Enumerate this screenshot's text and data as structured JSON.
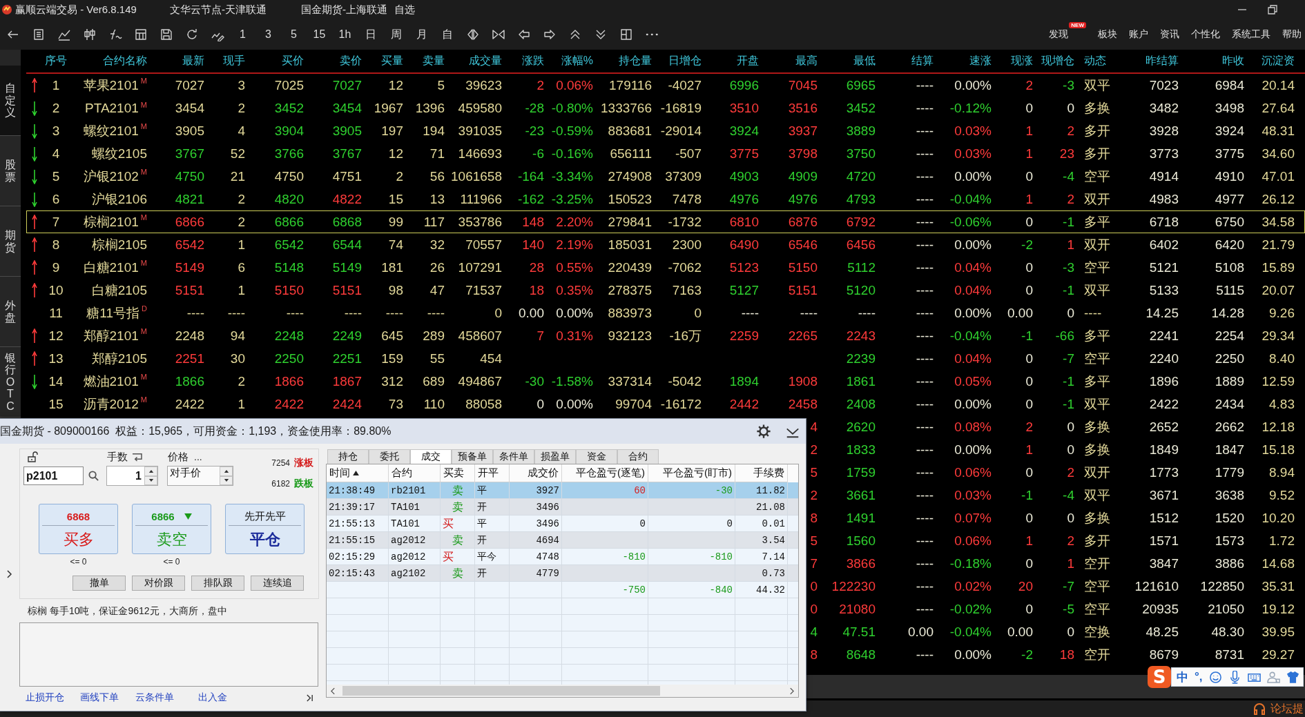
{
  "window": {
    "title_items": [
      "赢顺云端交易 - Ver6.8.149",
      "文华云节点-天津联通",
      "国金期货-上海联通",
      "自选"
    ]
  },
  "toolbar": {
    "periods": [
      "1",
      "3",
      "5",
      "15",
      "1h",
      "日",
      "周",
      "月",
      "自"
    ],
    "menu": [
      {
        "label": "发现",
        "badge": "NEW"
      },
      {
        "label": "板块"
      },
      {
        "label": "账户"
      },
      {
        "label": "资讯"
      },
      {
        "label": "个性化"
      },
      {
        "label": "系统工具"
      },
      {
        "label": "帮助"
      }
    ]
  },
  "sidebar": {
    "items": [
      {
        "label": "自定义",
        "selected": true
      },
      {
        "label": "股票",
        "selected": false
      },
      {
        "label": "期货",
        "selected": false
      },
      {
        "label": "外盘",
        "selected": false
      },
      {
        "label": "银行OTC",
        "selected": false
      }
    ]
  },
  "quote_table": {
    "columns": [
      "序号",
      "合约名称",
      "最新",
      "现手",
      "买价",
      "卖价",
      "买量",
      "卖量",
      "成交量",
      "涨跌",
      "涨幅%",
      "持仓量",
      "日增仓",
      "开盘",
      "最高",
      "最低",
      "结算",
      "速涨",
      "现涨",
      "现增仓",
      "动态",
      "昨结算",
      "昨收",
      "沉淀资"
    ],
    "rows": [
      {
        "kind": "rise",
        "selected": false,
        "cells": [
          "1",
          "苹果2101$^{M}$",
          {
            "text": "7027",
            "kind": "flat"
          },
          "3",
          {
            "text": "7025",
            "kind": "flat"
          },
          {
            "text": "7027",
            "kind": "fall"
          },
          "12",
          "5",
          "39623",
          {
            "text": "2",
            "kind": "rise"
          },
          {
            "text": "0.06%",
            "kind": "rise"
          },
          "179116",
          "-4027",
          {
            "text": "6996",
            "kind": "fall"
          },
          {
            "text": "7045",
            "kind": "rise"
          },
          {
            "text": "6965",
            "kind": "fall"
          },
          "----",
          {
            "text": "0.00%",
            "kind": "flat"
          },
          {
            "text": "2",
            "kind": "rise"
          },
          {
            "text": "-3",
            "kind": "fall"
          },
          "双平",
          "7023",
          "6984",
          "20.14"
        ]
      },
      {
        "kind": "fall",
        "selected": false,
        "cells": [
          "2",
          "PTA2101$^{M}$",
          {
            "text": "3454",
            "kind": "flat"
          },
          "2",
          {
            "text": "3452",
            "kind": "fall"
          },
          {
            "text": "3454",
            "kind": "fall"
          },
          "1967",
          "1396",
          "459580",
          {
            "text": "-28",
            "kind": "fall"
          },
          {
            "text": "-0.80%",
            "kind": "fall"
          },
          "1333766",
          "-16819",
          {
            "text": "3510",
            "kind": "rise"
          },
          {
            "text": "3516",
            "kind": "rise"
          },
          {
            "text": "3452",
            "kind": "fall"
          },
          "----",
          {
            "text": "-0.12%",
            "kind": "fall"
          },
          {
            "text": "0",
            "kind": "flat"
          },
          {
            "text": "0",
            "kind": "flat"
          },
          "多换",
          "3482",
          "3498",
          "27.64"
        ]
      },
      {
        "kind": "fall",
        "selected": false,
        "cells": [
          "3",
          "螺纹2101$^{M}$",
          {
            "text": "3905",
            "kind": "flat"
          },
          "4",
          {
            "text": "3904",
            "kind": "fall"
          },
          {
            "text": "3905",
            "kind": "fall"
          },
          "197",
          "194",
          "391035",
          {
            "text": "-23",
            "kind": "fall"
          },
          {
            "text": "-0.59%",
            "kind": "fall"
          },
          "883681",
          "-29014",
          {
            "text": "3924",
            "kind": "fall"
          },
          {
            "text": "3937",
            "kind": "rise"
          },
          {
            "text": "3889",
            "kind": "fall"
          },
          "----",
          {
            "text": "0.03%",
            "kind": "rise"
          },
          {
            "text": "1",
            "kind": "rise"
          },
          {
            "text": "2",
            "kind": "rise"
          },
          "多开",
          "3928",
          "3924",
          "48.31"
        ]
      },
      {
        "kind": "fall",
        "selected": false,
        "cells": [
          "4",
          "螺纹2105",
          {
            "text": "3767",
            "kind": "fall"
          },
          "52",
          {
            "text": "3766",
            "kind": "fall"
          },
          {
            "text": "3767",
            "kind": "fall"
          },
          "12",
          "71",
          "146693",
          {
            "text": "-6",
            "kind": "fall"
          },
          {
            "text": "-0.16%",
            "kind": "fall"
          },
          "656111",
          "-507",
          {
            "text": "3775",
            "kind": "rise"
          },
          {
            "text": "3798",
            "kind": "rise"
          },
          {
            "text": "3750",
            "kind": "fall"
          },
          "----",
          {
            "text": "0.03%",
            "kind": "rise"
          },
          {
            "text": "1",
            "kind": "rise"
          },
          {
            "text": "23",
            "kind": "rise"
          },
          "多开",
          "3773",
          "3775",
          "34.60"
        ]
      },
      {
        "kind": "fall",
        "selected": false,
        "cells": [
          "5",
          "沪银2102$^{M}$",
          {
            "text": "4750",
            "kind": "fall"
          },
          "21",
          {
            "text": "4750",
            "kind": "flat"
          },
          {
            "text": "4751",
            "kind": "flat"
          },
          "2",
          "56",
          "1061658",
          {
            "text": "-164",
            "kind": "fall"
          },
          {
            "text": "-3.34%",
            "kind": "fall"
          },
          "274908",
          "37309",
          {
            "text": "4903",
            "kind": "fall"
          },
          {
            "text": "4909",
            "kind": "fall"
          },
          {
            "text": "4720",
            "kind": "fall"
          },
          "----",
          {
            "text": "0.00%",
            "kind": "flat"
          },
          {
            "text": "0",
            "kind": "flat"
          },
          {
            "text": "-4",
            "kind": "fall"
          },
          "空平",
          "4914",
          "4910",
          "47.01"
        ]
      },
      {
        "kind": "fall",
        "selected": false,
        "cells": [
          "6",
          "沪银2106",
          {
            "text": "4821",
            "kind": "fall"
          },
          "2",
          {
            "text": "4820",
            "kind": "fall"
          },
          {
            "text": "4822",
            "kind": "rise"
          },
          "15",
          "13",
          "111966",
          {
            "text": "-162",
            "kind": "fall"
          },
          {
            "text": "-3.25%",
            "kind": "fall"
          },
          "150523",
          "7478",
          {
            "text": "4976",
            "kind": "fall"
          },
          {
            "text": "4976",
            "kind": "fall"
          },
          {
            "text": "4793",
            "kind": "fall"
          },
          "----",
          {
            "text": "-0.04%",
            "kind": "fall"
          },
          {
            "text": "1",
            "kind": "rise"
          },
          {
            "text": "2",
            "kind": "rise"
          },
          "双开",
          "4983",
          "4977",
          "26.12"
        ]
      },
      {
        "kind": "rise",
        "selected": true,
        "cells": [
          "7",
          "棕榈2101$^{M}$",
          {
            "text": "6866",
            "kind": "rise"
          },
          "2",
          {
            "text": "6866",
            "kind": "fall"
          },
          {
            "text": "6868",
            "kind": "fall"
          },
          "99",
          "117",
          "353786",
          {
            "text": "148",
            "kind": "rise"
          },
          {
            "text": "2.20%",
            "kind": "rise"
          },
          "279841",
          "-1732",
          {
            "text": "6810",
            "kind": "rise"
          },
          {
            "text": "6876",
            "kind": "rise"
          },
          {
            "text": "6792",
            "kind": "rise"
          },
          "----",
          {
            "text": "-0.06%",
            "kind": "fall"
          },
          {
            "text": "0",
            "kind": "flat"
          },
          {
            "text": "-1",
            "kind": "fall"
          },
          "多平",
          "6718",
          "6750",
          "34.58"
        ]
      },
      {
        "kind": "rise",
        "selected": false,
        "cells": [
          "8",
          "棕榈2105",
          {
            "text": "6542",
            "kind": "rise"
          },
          "1",
          {
            "text": "6542",
            "kind": "fall"
          },
          {
            "text": "6544",
            "kind": "fall"
          },
          "74",
          "32",
          "70557",
          {
            "text": "140",
            "kind": "rise"
          },
          {
            "text": "2.19%",
            "kind": "rise"
          },
          "185031",
          "2300",
          {
            "text": "6490",
            "kind": "rise"
          },
          {
            "text": "6546",
            "kind": "rise"
          },
          {
            "text": "6456",
            "kind": "rise"
          },
          "----",
          {
            "text": "0.00%",
            "kind": "flat"
          },
          {
            "text": "-2",
            "kind": "fall"
          },
          {
            "text": "1",
            "kind": "rise"
          },
          "双开",
          "6402",
          "6420",
          "21.79"
        ]
      },
      {
        "kind": "rise",
        "selected": false,
        "cells": [
          "9",
          "白糖2101$^{M}$",
          {
            "text": "5149",
            "kind": "rise"
          },
          "6",
          {
            "text": "5148",
            "kind": "fall"
          },
          {
            "text": "5149",
            "kind": "fall"
          },
          "181",
          "26",
          "107291",
          {
            "text": "28",
            "kind": "rise"
          },
          {
            "text": "0.55%",
            "kind": "rise"
          },
          "220439",
          "-7062",
          {
            "text": "5123",
            "kind": "rise"
          },
          {
            "text": "5150",
            "kind": "rise"
          },
          {
            "text": "5112",
            "kind": "fall"
          },
          "----",
          {
            "text": "0.04%",
            "kind": "rise"
          },
          {
            "text": "0",
            "kind": "flat"
          },
          {
            "text": "-3",
            "kind": "fall"
          },
          "空平",
          "5121",
          "5108",
          "15.89"
        ]
      },
      {
        "kind": "rise",
        "selected": false,
        "cells": [
          "10",
          "白糖2105",
          {
            "text": "5151",
            "kind": "rise"
          },
          "1",
          {
            "text": "5150",
            "kind": "rise"
          },
          {
            "text": "5151",
            "kind": "rise"
          },
          "98",
          "47",
          "71537",
          {
            "text": "18",
            "kind": "rise"
          },
          {
            "text": "0.35%",
            "kind": "rise"
          },
          "278375",
          "7163",
          {
            "text": "5127",
            "kind": "fall"
          },
          {
            "text": "5151",
            "kind": "rise"
          },
          {
            "text": "5120",
            "kind": "fall"
          },
          "----",
          {
            "text": "0.04%",
            "kind": "rise"
          },
          {
            "text": "0",
            "kind": "flat"
          },
          {
            "text": "-1",
            "kind": "fall"
          },
          "双平",
          "5133",
          "5115",
          "20.07"
        ]
      },
      {
        "kind": "flat",
        "selected": false,
        "cells": [
          "11",
          "糖11号指$^{D}$",
          {
            "text": "----",
            "kind": "flat"
          },
          "----",
          {
            "text": "----",
            "kind": "flat"
          },
          {
            "text": "----",
            "kind": "flat"
          },
          "----",
          "----",
          "0",
          {
            "text": "0.00",
            "kind": "flat"
          },
          {
            "text": "0.00%",
            "kind": "flat"
          },
          "883973",
          "0",
          {
            "text": "----",
            "kind": "flat"
          },
          {
            "text": "----",
            "kind": "flat"
          },
          {
            "text": "----",
            "kind": "flat"
          },
          "----",
          {
            "text": "0.00%",
            "kind": "flat"
          },
          {
            "text": "0.00",
            "kind": "flat"
          },
          {
            "text": "0",
            "kind": "flat"
          },
          "----",
          "14.25",
          "14.28",
          "9.26"
        ]
      },
      {
        "kind": "rise",
        "selected": false,
        "cells": [
          "12",
          "郑醇2101$^{M}$",
          {
            "text": "2248",
            "kind": "flat"
          },
          "94",
          {
            "text": "2248",
            "kind": "fall"
          },
          {
            "text": "2249",
            "kind": "fall"
          },
          "645",
          "289",
          "458607",
          {
            "text": "7",
            "kind": "rise"
          },
          {
            "text": "0.31%",
            "kind": "rise"
          },
          "932123",
          "-16万",
          {
            "text": "2259",
            "kind": "rise"
          },
          {
            "text": "2265",
            "kind": "rise"
          },
          {
            "text": "2243",
            "kind": "rise"
          },
          "----",
          {
            "text": "-0.04%",
            "kind": "fall"
          },
          {
            "text": "-1",
            "kind": "fall"
          },
          {
            "text": "-66",
            "kind": "fall"
          },
          "多平",
          "2241",
          "2254",
          "29.34"
        ]
      },
      {
        "kind": "rise",
        "selected": false,
        "cells": [
          "13",
          "郑醇2105",
          {
            "text": "2251",
            "kind": "rise"
          },
          "30",
          {
            "text": "2250",
            "kind": "fall"
          },
          {
            "text": "2251",
            "kind": "fall"
          },
          "159",
          "55",
          "454",
          null,
          null,
          null,
          null,
          null,
          null,
          {
            "text": "2239",
            "kind": "fall"
          },
          "----",
          {
            "text": "0.04%",
            "kind": "rise"
          },
          {
            "text": "0",
            "kind": "flat"
          },
          {
            "text": "-7",
            "kind": "fall"
          },
          "空平",
          "2240",
          "2250",
          "8.40"
        ]
      },
      {
        "kind": "fall",
        "selected": false,
        "cells": [
          "14",
          "燃油2101$^{M}$",
          {
            "text": "1866",
            "kind": "fall"
          },
          "2",
          {
            "text": "1866",
            "kind": "rise"
          },
          {
            "text": "1867",
            "kind": "rise"
          },
          "312",
          "689",
          "494867",
          {
            "text": "-30",
            "kind": "fall"
          },
          {
            "text": "-1.58%",
            "kind": "fall"
          },
          "337314",
          "-5042",
          {
            "text": "1894",
            "kind": "fall"
          },
          {
            "text": "1908",
            "kind": "rise"
          },
          {
            "text": "1861",
            "kind": "fall"
          },
          "----",
          {
            "text": "0.05%",
            "kind": "rise"
          },
          {
            "text": "0",
            "kind": "flat"
          },
          {
            "text": "-1",
            "kind": "fall"
          },
          "多平",
          "1896",
          "1889",
          "12.59"
        ]
      },
      {
        "kind": "flat",
        "selected": false,
        "cells": [
          "15",
          "沥青2012$^{M}$",
          {
            "text": "2422",
            "kind": "flat"
          },
          "1",
          {
            "text": "2422",
            "kind": "rise"
          },
          {
            "text": "2424",
            "kind": "rise"
          },
          "73",
          "110",
          "88058",
          {
            "text": "0",
            "kind": "flat"
          },
          {
            "text": "0.00%",
            "kind": "flat"
          },
          "99704",
          "-16172",
          {
            "text": "2442",
            "kind": "rise"
          },
          {
            "text": "2458",
            "kind": "rise"
          },
          {
            "text": "2408",
            "kind": "fall"
          },
          "----",
          {
            "text": "0.00%",
            "kind": "flat"
          },
          {
            "text": "0",
            "kind": "flat"
          },
          {
            "text": "-1",
            "kind": "fall"
          },
          "双平",
          "2422",
          "2434",
          "4.83"
        ]
      },
      {
        "selected": false,
        "cells": [
          {
            "text": "4",
            "kind": "rise"
          },
          {
            "text": "2620",
            "kind": "fall"
          },
          "----",
          {
            "text": "0.08%",
            "kind": "rise"
          },
          {
            "text": "2",
            "kind": "rise"
          },
          {
            "text": "0",
            "kind": "flat"
          },
          "多换",
          "2652",
          "2662",
          "12.18"
        ]
      },
      {
        "selected": false,
        "cells": [
          {
            "text": "2",
            "kind": "rise"
          },
          {
            "text": "1833",
            "kind": "fall"
          },
          "----",
          {
            "text": "0.00%",
            "kind": "flat"
          },
          {
            "text": "1",
            "kind": "rise"
          },
          {
            "text": "0",
            "kind": "flat"
          },
          "多换",
          "1849",
          "1847",
          "15.18"
        ]
      },
      {
        "selected": false,
        "cells": [
          {
            "text": "5",
            "kind": "rise"
          },
          {
            "text": "1759",
            "kind": "fall"
          },
          "----",
          {
            "text": "0.06%",
            "kind": "rise"
          },
          {
            "text": "0",
            "kind": "flat"
          },
          {
            "text": "2",
            "kind": "rise"
          },
          "双开",
          "1773",
          "1779",
          "8.94"
        ]
      },
      {
        "selected": false,
        "cells": [
          {
            "text": "2",
            "kind": "rise"
          },
          {
            "text": "3661",
            "kind": "fall"
          },
          "----",
          {
            "text": "0.03%",
            "kind": "rise"
          },
          {
            "text": "-1",
            "kind": "fall"
          },
          {
            "text": "-4",
            "kind": "fall"
          },
          "双平",
          "3671",
          "3638",
          "9.52"
        ]
      },
      {
        "selected": false,
        "cells": [
          {
            "text": "8",
            "kind": "rise"
          },
          {
            "text": "1491",
            "kind": "fall"
          },
          "----",
          {
            "text": "0.07%",
            "kind": "rise"
          },
          {
            "text": "0",
            "kind": "flat"
          },
          {
            "text": "0",
            "kind": "flat"
          },
          "多换",
          "1512",
          "1520",
          "10.20"
        ]
      },
      {
        "selected": false,
        "cells": [
          {
            "text": "5",
            "kind": "rise"
          },
          {
            "text": "1560",
            "kind": "fall"
          },
          "----",
          {
            "text": "0.06%",
            "kind": "rise"
          },
          {
            "text": "1",
            "kind": "rise"
          },
          {
            "text": "2",
            "kind": "rise"
          },
          "多开",
          "1571",
          "1573",
          "1.72"
        ]
      },
      {
        "selected": false,
        "cells": [
          {
            "text": "7",
            "kind": "rise"
          },
          {
            "text": "3866",
            "kind": "rise"
          },
          "----",
          {
            "text": "-0.18%",
            "kind": "fall"
          },
          {
            "text": "0",
            "kind": "flat"
          },
          {
            "text": "1",
            "kind": "rise"
          },
          "空开",
          "3847",
          "3886",
          "14.68"
        ]
      },
      {
        "selected": false,
        "cells": [
          {
            "text": "0",
            "kind": "rise"
          },
          {
            "text": "122230",
            "kind": "rise"
          },
          "----",
          {
            "text": "0.02%",
            "kind": "rise"
          },
          {
            "text": "20",
            "kind": "rise"
          },
          {
            "text": "-7",
            "kind": "fall"
          },
          "空平",
          "121610",
          "122850",
          "35.31"
        ]
      },
      {
        "selected": false,
        "cells": [
          {
            "text": "0",
            "kind": "rise"
          },
          {
            "text": "21080",
            "kind": "rise"
          },
          "----",
          {
            "text": "-0.02%",
            "kind": "fall"
          },
          {
            "text": "0",
            "kind": "flat"
          },
          {
            "text": "-5",
            "kind": "fall"
          },
          "空平",
          "20935",
          "21050",
          "19.12"
        ]
      },
      {
        "selected": false,
        "cells": [
          {
            "text": "4",
            "kind": "fall"
          },
          {
            "text": "47.51",
            "kind": "fall"
          },
          "0.00",
          {
            "text": "-0.04%",
            "kind": "fall"
          },
          {
            "text": "0.00",
            "kind": "flat"
          },
          {
            "text": "0",
            "kind": "flat"
          },
          "空换",
          "48.25",
          "48.30",
          "39.95"
        ]
      },
      {
        "selected": false,
        "cells": [
          {
            "text": "8",
            "kind": "rise"
          },
          {
            "text": "8648",
            "kind": "fall"
          },
          "----",
          {
            "text": "0.00%",
            "kind": "flat"
          },
          {
            "text": "-2",
            "kind": "fall"
          },
          {
            "text": "18",
            "kind": "rise"
          },
          "空开",
          "8679",
          "8731",
          "29.27"
        ]
      }
    ]
  },
  "order_window": {
    "title": "国金期货 - 809000166  权益：15,965，可用资金：1,193，资金使用率：89.80%",
    "order_panel": {
      "contract": "p2101",
      "lots": {
        "label": "手数",
        "value": "1"
      },
      "price": {
        "label": "价格",
        "more": "...",
        "value": "对手价"
      },
      "limits": [
        {
          "kind": "up",
          "price": "7254",
          "label": "涨板"
        },
        {
          "kind": "down",
          "price": "6182",
          "label": "跌板"
        }
      ],
      "actions": [
        {
          "kind": "buy",
          "price": "6868",
          "falling": false,
          "label": "买多",
          "limit": "<= 0"
        },
        {
          "kind": "sell",
          "price": "6866",
          "falling": true,
          "label": "卖空",
          "limit": "<= 0"
        },
        {
          "kind": "close",
          "price": "先开先平",
          "falling": false,
          "label": "平仓"
        }
      ],
      "buttons": [
        "撤单",
        "对价跟",
        "排队跟",
        "连续追"
      ]
    },
    "info": "棕榈 每手10吨，保证金9612元，大商所，盘中",
    "links": [
      "止损开仓",
      "画线下单",
      "云条件单",
      "出入金"
    ],
    "tabs": [
      {
        "label": "持仓",
        "selected": false
      },
      {
        "label": "委托",
        "selected": false
      },
      {
        "label": "成交",
        "selected": true
      },
      {
        "label": "预备单",
        "selected": false
      },
      {
        "label": "条件单",
        "selected": false
      },
      {
        "label": "损盈单",
        "selected": false
      },
      {
        "label": "资金",
        "selected": false
      },
      {
        "label": "合约",
        "selected": false
      }
    ],
    "fills": {
      "columns": [
        {
          "label": "时间",
          "sorted": true
        },
        {
          "label": "合约",
          "sorted": false
        },
        {
          "label": "买卖",
          "sorted": false
        },
        {
          "label": "开平",
          "sorted": false
        },
        {
          "label": "成交价",
          "sorted": false
        },
        {
          "label": "平仓盈亏(逐笔)",
          "sorted": false
        },
        {
          "label": "平仓盈亏(盯市)",
          "sorted": false
        },
        {
          "label": "手续费",
          "sorted": false
        }
      ],
      "rows": [
        {
          "selected": true,
          "cells": [
            "21:38:49",
            "rb2101",
            {
              "text": "卖",
              "kind": "sell"
            },
            "平",
            "3927",
            {
              "text": "60",
              "kind": "rise"
            },
            {
              "text": "-30",
              "kind": "fall"
            },
            "11.82"
          ]
        },
        {
          "selected": false,
          "cells": [
            "21:39:17",
            "TA101",
            {
              "text": "卖",
              "kind": "sell"
            },
            "开",
            "3496",
            null,
            null,
            "21.08"
          ]
        },
        {
          "selected": false,
          "cells": [
            "21:55:13",
            "TA101",
            {
              "text": "买",
              "kind": "buy"
            },
            "平",
            "3496",
            {
              "text": "0",
              "kind": "flat"
            },
            {
              "text": "0",
              "kind": "flat"
            },
            "0.01"
          ]
        },
        {
          "selected": false,
          "cells": [
            "21:55:15",
            "ag2012",
            {
              "text": "卖",
              "kind": "sell"
            },
            "开",
            "4694",
            null,
            null,
            "3.54"
          ]
        },
        {
          "selected": false,
          "cells": [
            "02:15:29",
            "ag2012",
            {
              "text": "买",
              "kind": "buy"
            },
            "平今",
            "4748",
            {
              "text": "-810",
              "kind": "fall"
            },
            {
              "text": "-810",
              "kind": "fall"
            },
            "7.14"
          ]
        },
        {
          "selected": false,
          "cells": [
            "02:15:43",
            "ag2102",
            {
              "text": "卖",
              "kind": "sell"
            },
            "开",
            "4779",
            null,
            null,
            "0.73"
          ]
        },
        {
          "selected": false,
          "cells": [
            null,
            null,
            null,
            null,
            null,
            {
              "text": "-750",
              "kind": "fall"
            },
            {
              "text": "-840",
              "kind": "fall"
            },
            "44.32"
          ]
        }
      ]
    }
  },
  "status_bar": {
    "link": "论坛提"
  },
  "input_method_bar": {
    "logo": "S",
    "mode": "中",
    "punctuation": "°,"
  }
}
